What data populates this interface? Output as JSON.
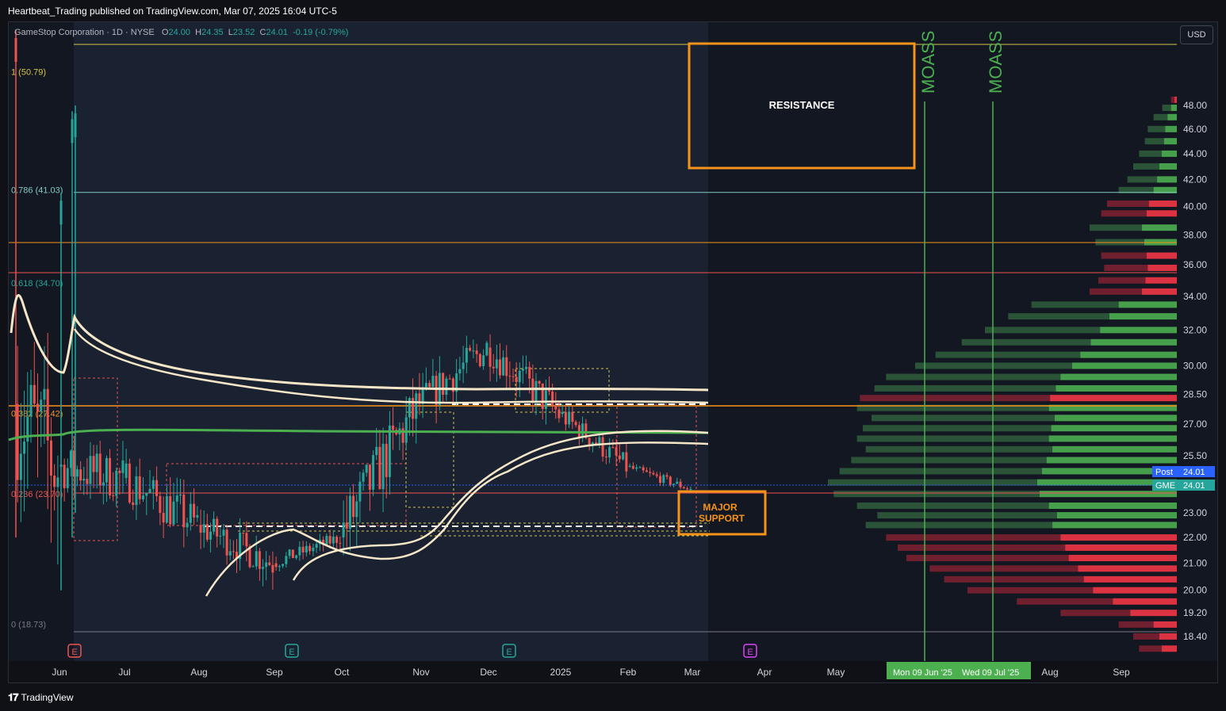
{
  "header": {
    "published_line": "Heartbeat_Trading published on TradingView.com, Mar 07, 2025 16:04 UTC-5"
  },
  "footer": {
    "logo_text": "TradingView"
  },
  "symbol": {
    "name": "GameStop Corporation",
    "interval": "1D",
    "exchange": "NYSE",
    "o_label": "O",
    "open": "24.00",
    "h_label": "H",
    "high": "24.35",
    "l_label": "L",
    "low": "23.52",
    "c_label": "C",
    "close": "24.01",
    "change": "-0.19 (-0.79%)"
  },
  "currency_button": "USD",
  "colors": {
    "background": "#131722",
    "bull": "#26a69a",
    "bear": "#ef5350",
    "annotation": "#f7931a",
    "moass": "#4caf50",
    "vwap": "#f5e6c8"
  },
  "annotations": {
    "resistance": "RESISTANCE",
    "support_line1": "MAJOR",
    "support_line2": "SUPPORT",
    "moass_1": "MOASS",
    "moass_2": "MOASS",
    "moass_date_1": "Mon 09 Jun '25",
    "moass_date_2": "Wed 09 Jul '25"
  },
  "price_tags": {
    "post_label": "Post",
    "post_value": "24.01",
    "sym_label": "GME",
    "sym_value": "24.01"
  },
  "chart_data": {
    "type": "candlestick",
    "y_scale": "log",
    "ylim": [
      17.6,
      55
    ],
    "y_ticks": [
      "48.00",
      "46.00",
      "44.00",
      "42.00",
      "40.00",
      "38.00",
      "36.00",
      "34.00",
      "32.00",
      "30.00",
      "28.50",
      "27.00",
      "25.50",
      "23.00",
      "22.00",
      "21.00",
      "20.00",
      "19.20",
      "18.40"
    ],
    "x_ticks": [
      "Jun",
      "Jul",
      "Aug",
      "Sep",
      "Oct",
      "Nov",
      "Dec",
      "2025",
      "Feb",
      "Mar",
      "Apr",
      "May",
      "Aug",
      "Sep"
    ],
    "fib_levels": [
      {
        "label": "1 (50.79)",
        "value": 50.79,
        "color": "#d4c44a"
      },
      {
        "label": "0.786 (41.03)",
        "value": 41.03,
        "color": "#80cbc4"
      },
      {
        "label": "0.618 (34.70)",
        "value": 34.7,
        "color": "#26a69a"
      },
      {
        "label": "0.382 (27.42)",
        "value": 27.42,
        "color": "#f7931a"
      },
      {
        "label": "0.236 (23.70)",
        "value": 23.7,
        "color": "#ef5350"
      },
      {
        "label": "0 (18.73)",
        "value": 18.73,
        "color": "#787b86"
      }
    ],
    "earnings_markers": [
      {
        "month": "Jun",
        "type": "E",
        "color": "#ef5350"
      },
      {
        "month": "Sep",
        "type": "E",
        "color": "#26a69a"
      },
      {
        "month": "Dec",
        "type": "E",
        "color": "#26a69a"
      },
      {
        "month": "Apr",
        "type": "E",
        "color": "#e040fb"
      }
    ],
    "monthly_ohlc": [
      {
        "x": "Jun",
        "open": 28.0,
        "high": 47.5,
        "low": 19.5,
        "close": 25.0
      },
      {
        "x": "Jul",
        "open": 25.0,
        "high": 30.0,
        "low": 21.5,
        "close": 24.5
      },
      {
        "x": "Aug",
        "open": 24.5,
        "high": 26.5,
        "low": 19.0,
        "close": 22.5
      },
      {
        "x": "Sep",
        "open": 22.5,
        "high": 25.0,
        "low": 19.6,
        "close": 21.0
      },
      {
        "x": "Oct",
        "open": 21.0,
        "high": 22.5,
        "low": 20.2,
        "close": 22.0
      },
      {
        "x": "Nov",
        "open": 22.0,
        "high": 32.0,
        "low": 21.2,
        "close": 28.0
      },
      {
        "x": "Dec",
        "open": 28.0,
        "high": 34.5,
        "low": 26.5,
        "close": 31.0
      },
      {
        "x": "2025",
        "open": 31.0,
        "high": 34.0,
        "low": 26.5,
        "close": 27.5
      },
      {
        "x": "Feb",
        "open": 27.5,
        "high": 29.0,
        "low": 24.5,
        "close": 25.0
      },
      {
        "x": "Mar",
        "open": 25.0,
        "high": 25.2,
        "low": 23.5,
        "close": 24.01
      }
    ]
  }
}
